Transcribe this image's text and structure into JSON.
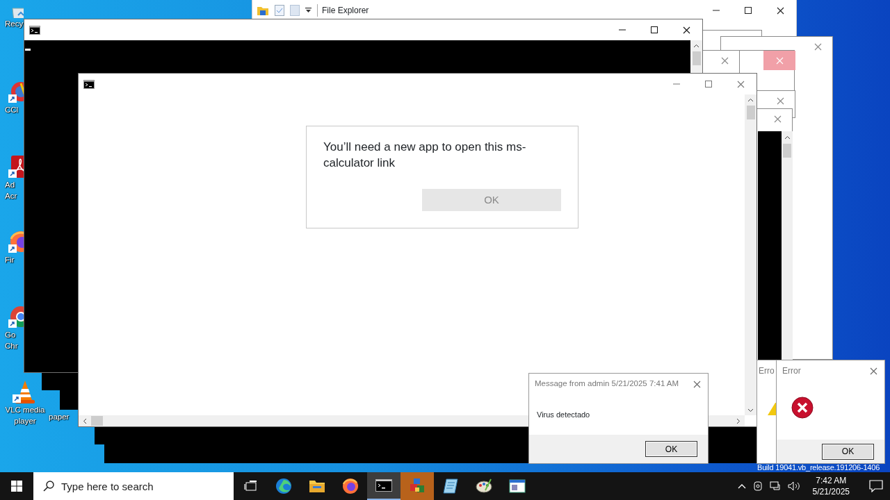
{
  "desktop": {
    "icon_columns": [
      [
        {
          "kind": "recycle-bin",
          "label_lines": [
            "Recy"
          ]
        },
        {
          "kind": "ccleaner",
          "shortcut": true,
          "label_lines": [
            "CCl"
          ]
        },
        {
          "kind": "acrobat",
          "shortcut": true,
          "label_lines": [
            "Ad",
            "Acr"
          ]
        },
        {
          "kind": "firefox",
          "shortcut": true,
          "label_lines": [
            "Fir"
          ]
        },
        {
          "kind": "chrome",
          "shortcut": true,
          "label_lines": [
            "Go",
            "Chr"
          ]
        },
        {
          "kind": "vlc",
          "shortcut": true,
          "label_lines": [
            "VLC media",
            "player"
          ]
        }
      ],
      [
        {
          "label_lines": [
            "paper"
          ]
        }
      ]
    ],
    "build_text": "Build 19041.vb_release.191206-1406"
  },
  "file_explorer": {
    "title": "File Explorer"
  },
  "console_windows": [
    {
      "kind": "black"
    },
    {
      "kind": "white"
    }
  ],
  "app_dialog": {
    "message": "You’ll need a new app to open this ms-calculator link",
    "button": {
      "label": "OK",
      "disabled": true
    }
  },
  "message_box": {
    "title": "Message from admin 5/21/2025 7:41 AM",
    "text": "Virus detectado",
    "button": "OK"
  },
  "error_boxes": [
    {
      "kind": "warning",
      "title": "Erro"
    },
    {
      "kind": "error",
      "title": "Error",
      "button": "OK"
    }
  ],
  "taskbar": {
    "search_placeholder": "Type here to search",
    "apps": [
      {
        "kind": "task-view",
        "active": false,
        "flashing": false
      },
      {
        "kind": "edge",
        "active": false,
        "flashing": false
      },
      {
        "kind": "folder",
        "active": false,
        "flashing": false
      },
      {
        "kind": "firefox",
        "active": false,
        "flashing": false
      },
      {
        "kind": "console",
        "active": true,
        "flashing": false
      },
      {
        "kind": "cubes",
        "active": false,
        "flashing": true
      },
      {
        "kind": "notepad",
        "active": false,
        "flashing": false
      },
      {
        "kind": "paint",
        "active": false,
        "flashing": false
      },
      {
        "kind": "window",
        "active": false,
        "flashing": false
      }
    ],
    "time": "7:42 AM",
    "date": "5/21/2025"
  }
}
